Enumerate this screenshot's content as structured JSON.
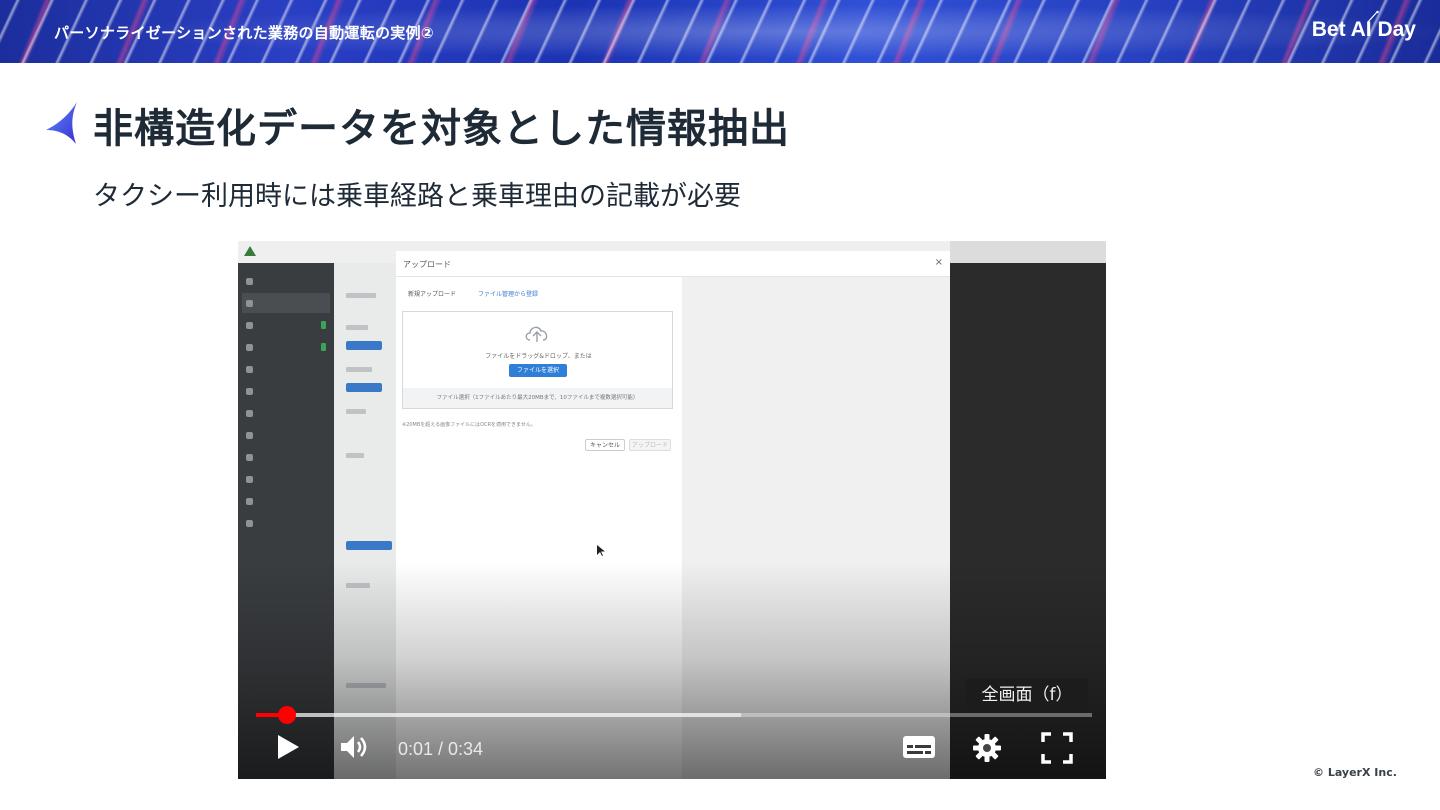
{
  "header": {
    "banner_title": "パーソナライゼーションされた業務の自動運転の実例②",
    "brand": "Bet AI Day"
  },
  "slide": {
    "title": "非構造化データを対象とした情報抽出",
    "subtitle": "タクシー利用時には乗車経路と乗車理由の記載が必要"
  },
  "video": {
    "tooltip": "全画面（f）",
    "time": "0:01 / 0:34",
    "progress_played_fraction": 0.037,
    "progress_buffered_fraction": 0.58,
    "progress_color": "#ff0000",
    "app_modal": {
      "title": "アップロード",
      "close": "×",
      "tab_new": "新規アップロード",
      "tab_files": "ファイル管理から登録",
      "drop_text": "ファイルをドラッグ&ドロップ、または",
      "select_button": "ファイルを選択",
      "drop_footer": "ファイル選択（1ファイルあたり最大20MBまで、10ファイルまで複数選択可能）",
      "note": "※20MBを超える画像ファイルにはOCRを適用できません。",
      "cancel_button": "キャンセル",
      "upload_button": "アップロード"
    }
  },
  "footer": {
    "copyright": "© LayerX Inc."
  },
  "colors": {
    "banner_blue": "#2a3fc4",
    "title_text": "#1e2a36",
    "accent_star": "#3d4fe0"
  }
}
